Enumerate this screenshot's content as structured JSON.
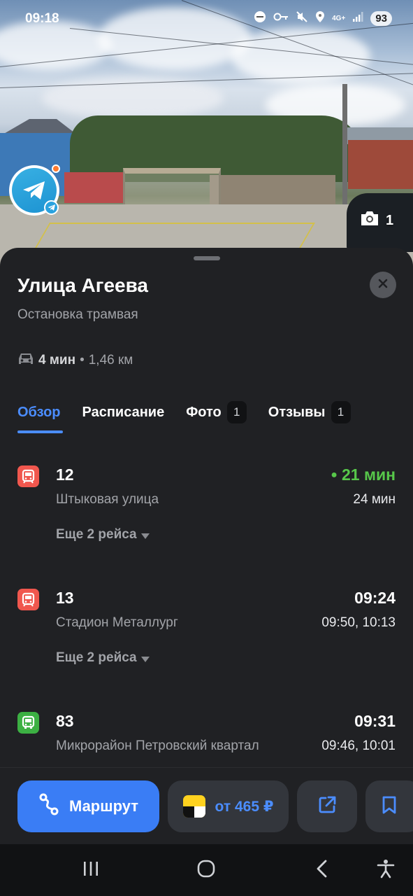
{
  "status_bar": {
    "time": "09:18",
    "network": "4G+",
    "battery": "93"
  },
  "photo": {
    "count": "1",
    "icons": {
      "camera": "camera-icon",
      "telegram": "telegram-icon"
    }
  },
  "place": {
    "title": "Улица Агеева",
    "subtitle": "Остановка трамвая",
    "travel_time": "4 мин",
    "travel_separator": "•",
    "travel_distance": "1,46 км"
  },
  "tabs": [
    {
      "label": "Обзор",
      "active": true
    },
    {
      "label": "Расписание"
    },
    {
      "label": "Фото",
      "count": "1"
    },
    {
      "label": "Отзывы",
      "count": "1"
    }
  ],
  "routes": [
    {
      "number": "12",
      "destination": "Штыковая улица",
      "time": "21 мин",
      "live": true,
      "next": "24 мин",
      "more": "Еще 2 рейса",
      "vehicle": "tram",
      "color": "#f0574e"
    },
    {
      "number": "13",
      "destination": "Стадион Металлург",
      "time": "09:24",
      "next": "09:50, 10:13",
      "more": "Еще 2 рейса",
      "vehicle": "tram",
      "color": "#f0574e"
    },
    {
      "number": "83",
      "destination": "Микрорайон Петровский квартал",
      "time": "09:31",
      "next": "09:46, 10:01",
      "vehicle": "bus",
      "color": "#3cb043"
    }
  ],
  "actions": {
    "route_label": "Маршрут",
    "taxi_label": "от 465 ₽"
  },
  "colors": {
    "accent": "#3a7df5",
    "live": "#57c74a",
    "sheet": "#202124"
  }
}
